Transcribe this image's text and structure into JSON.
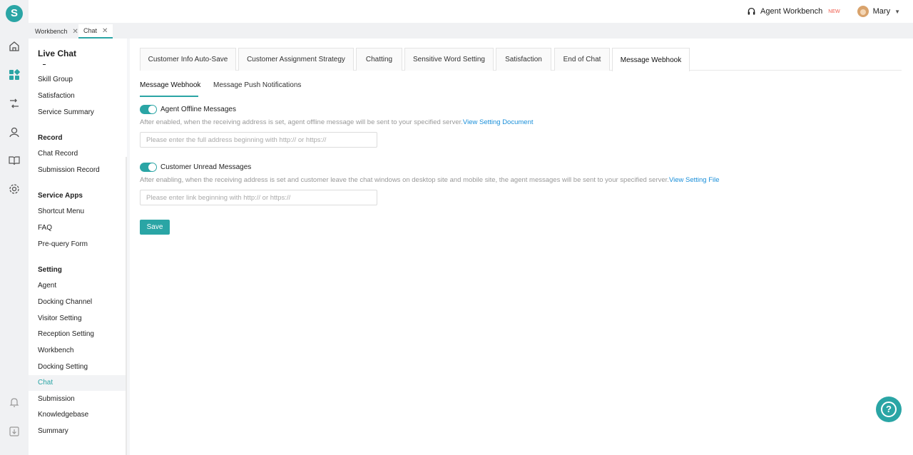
{
  "app": {
    "logo_letter": "S"
  },
  "topbar": {
    "workbench_label": "Agent Workbench",
    "new_badge": "NEW",
    "user_name": "Mary"
  },
  "page_tabs": [
    {
      "label": "Workbench",
      "active": false
    },
    {
      "label": "Chat",
      "active": true
    }
  ],
  "sidebar": {
    "title": "Live Chat",
    "top_items": [
      "Skill Group",
      "Satisfaction",
      "Service Summary"
    ],
    "sections": [
      {
        "title": "Record",
        "items": [
          "Chat Record",
          "Submission Record"
        ]
      },
      {
        "title": "Service Apps",
        "items": [
          "Shortcut Menu",
          "FAQ",
          "Pre-query Form"
        ]
      },
      {
        "title": "Setting",
        "items": [
          "Agent",
          "Docking Channel",
          "Visitor Setting",
          "Reception Setting",
          "Workbench",
          "Docking Setting",
          "Chat",
          "Submission",
          "Knowledgebase",
          "Summary"
        ]
      }
    ],
    "active_item": "Chat"
  },
  "config_tabs": [
    "Customer Info Auto-Save",
    "Customer Assignment Strategy",
    "Chatting",
    "Sensitive Word Setting",
    "Satisfaction",
    "End of Chat",
    "Message Webhook"
  ],
  "active_config_tab": "Message Webhook",
  "sub_tabs": [
    "Message Webhook",
    "Message Push Notifications"
  ],
  "offline": {
    "label": "Agent Offline Messages",
    "enabled": true,
    "desc": "After enabled, when the receiving address is set, agent offline message will be sent to your specified server.",
    "link": "View Setting Document",
    "placeholder": "Please enter the full address beginning with http:// or https://"
  },
  "unread": {
    "label": "Customer Unread Messages",
    "enabled": true,
    "desc": "After enabling, when the receiving address is set and customer leave the chat windows on desktop site and mobile site, the agent messages will be sent to your specified server.",
    "link": "View Setting File",
    "placeholder": "Please enter link beginning with http:// or https://"
  },
  "save_label": "Save",
  "help_label": "?",
  "colors": {
    "accent": "#2aa5a5",
    "link": "#1a8fd9"
  }
}
